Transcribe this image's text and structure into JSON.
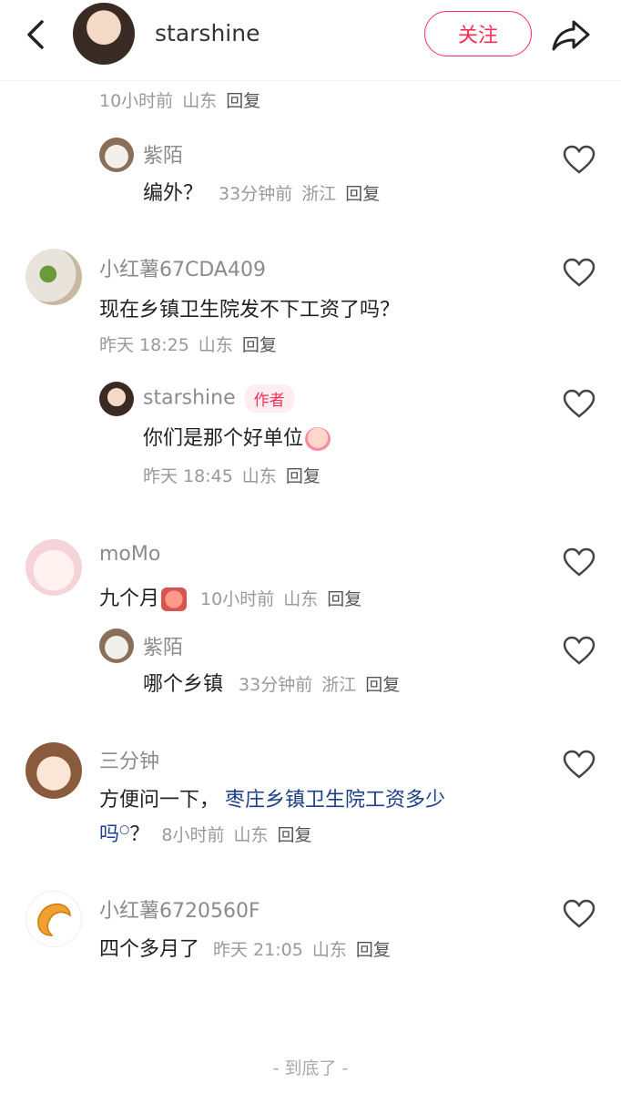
{
  "header": {
    "username": "starshine",
    "follow_label": "关注"
  },
  "top_meta": {
    "time": "10小时前",
    "location": "山东",
    "reply": "回复"
  },
  "comments": [
    {
      "username": "紫陌",
      "text": "编外？",
      "time": "33分钟前",
      "location": "浙江",
      "reply": "回复"
    },
    {
      "username": "小红薯67CDA409",
      "text": "现在乡镇卫生院发不下工资了吗？",
      "time": "昨天 18:25",
      "location": "山东",
      "reply": "回复"
    },
    {
      "username": "starshine",
      "badge": "作者",
      "text": "你们是那个好单位",
      "time": "昨天 18:45",
      "location": "山东",
      "reply": "回复"
    },
    {
      "username": "moMo",
      "text": "九个月",
      "time": "10小时前",
      "location": "山东",
      "reply": "回复"
    },
    {
      "username": "紫陌",
      "text": "哪个乡镇",
      "time": "33分钟前",
      "location": "浙江",
      "reply": "回复"
    },
    {
      "username": "三分钟",
      "text_prefix": "方便问一下，",
      "text_link": "枣庄乡镇卫生院工资多少",
      "text_link2": "吗",
      "text_suffix": "？",
      "time": "8小时前",
      "location": "山东",
      "reply": "回复"
    },
    {
      "username": "小红薯6720560F",
      "text": "四个多月了",
      "time": "昨天 21:05",
      "location": "山东",
      "reply": "回复"
    }
  ],
  "footer": {
    "end_text": "- 到底了 -"
  },
  "colors": {
    "accent": "#ff2d55",
    "link": "#1e3f8a"
  }
}
